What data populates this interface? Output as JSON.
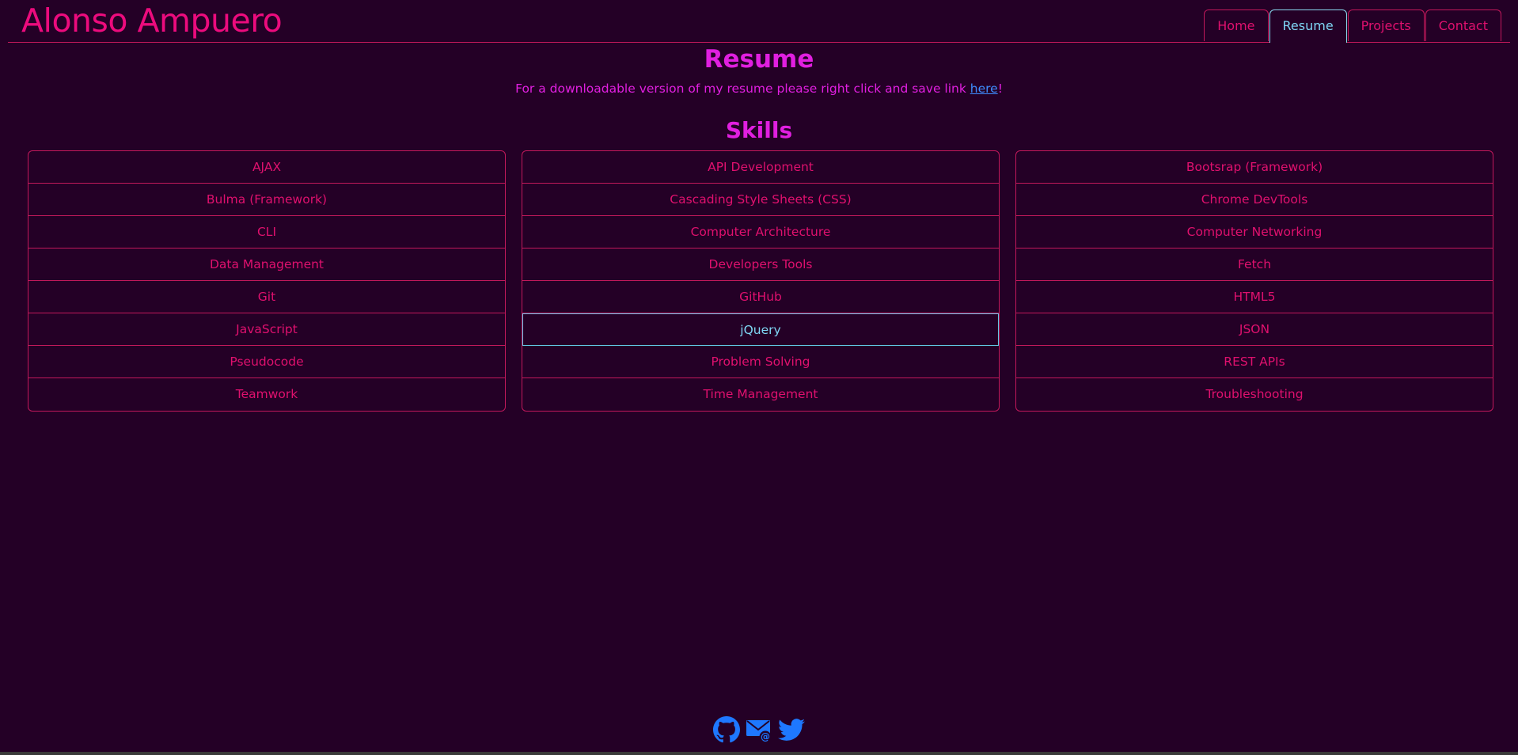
{
  "header": {
    "title": "Alonso Ampuero",
    "nav": [
      "Home",
      "Resume",
      "Projects",
      "Contact"
    ],
    "active_tab": "Resume"
  },
  "resume": {
    "title": "Resume",
    "note_text": "For a downloadable version of my resume please right click and save link ",
    "note_link": "here",
    "note_end": "!"
  },
  "skills": {
    "title": "Skills",
    "columns": [
      [
        "AJAX",
        "Bulma (Framework)",
        "CLI",
        "Data Management",
        "Git",
        "JavaScript",
        "Pseudocode",
        "Teamwork"
      ],
      [
        "API Development",
        "Cascading Style Sheets (CSS)",
        "Computer Architecture",
        "Developers Tools",
        "GitHub",
        "jQuery",
        "Problem Solving",
        "Time Management"
      ],
      [
        "Bootsrap (Framework)",
        "Chrome DevTools",
        "Computer Networking",
        "Fetch",
        "HTML5",
        "JSON",
        "REST APIs",
        "Troubleshooting"
      ]
    ],
    "highlighted": "jQuery"
  },
  "footer": {
    "icons": [
      "github-icon",
      "email-icon",
      "twitter-icon"
    ],
    "icon_color": "#1e78ff"
  },
  "colors": {
    "background": "#240026",
    "accent": "#ec0b7d",
    "heading": "#e11fe0",
    "highlight": "#7fd6f5",
    "link": "#3f8cff"
  }
}
